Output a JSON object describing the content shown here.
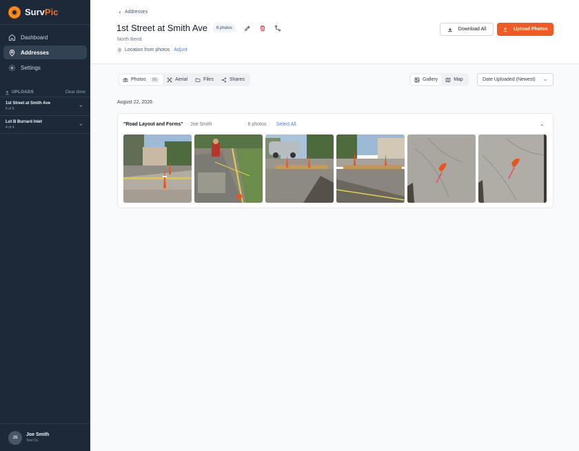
{
  "brand": {
    "name_part1": "Surv",
    "name_part2": "Pic",
    "accent": "#f97316"
  },
  "sidebar": {
    "nav": [
      {
        "label": "Dashboard",
        "icon": "home-icon"
      },
      {
        "label": "Addresses",
        "icon": "map-pin-icon",
        "active": true
      },
      {
        "label": "Settings",
        "icon": "gear-icon"
      }
    ],
    "uploads_label": "UPLOADS",
    "clear_label": "Clear done",
    "uploads": [
      {
        "title": "1st Street at Smith Ave",
        "status": "6 of 6"
      },
      {
        "title": "Lot B Burrard Inlet",
        "status": "4 of 4"
      }
    ],
    "user": {
      "initials": "JS",
      "name": "Joe Smith",
      "company": "Test Co."
    }
  },
  "header": {
    "back_label": "Addresses",
    "title": "1st Street at Smith Ave",
    "photo_badge": "6 photos",
    "subtitle": "North Bend",
    "location_label": "Location from photos",
    "adjust_label": "Adjust",
    "download_label": "Download All",
    "upload_label": "Upload Photos",
    "upload_color": "#f15a22"
  },
  "tabs": [
    {
      "label": "Photos",
      "count": "6",
      "icon": "camera-icon",
      "active": true
    },
    {
      "label": "Aerial",
      "icon": "drone-icon"
    },
    {
      "label": "Files",
      "icon": "folder-icon"
    },
    {
      "label": "Shares",
      "icon": "share-icon"
    }
  ],
  "views": [
    {
      "label": "Gallery",
      "icon": "image-icon",
      "active": true
    },
    {
      "label": "Map",
      "icon": "map-icon"
    }
  ],
  "sort": {
    "selected": "Date Uploaded (Newest)"
  },
  "gallery": {
    "date": "August 22, 2026",
    "group": {
      "name": "\"Road Layout and Forms\"",
      "author": "Joe Smith",
      "count": "6 photos",
      "select_all": "Select All"
    }
  }
}
